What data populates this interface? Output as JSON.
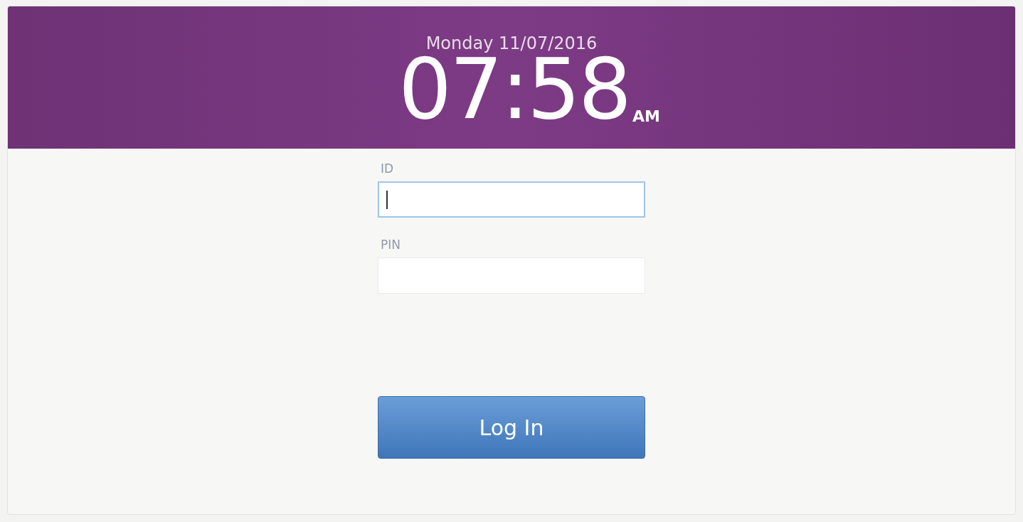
{
  "header": {
    "date": "Monday 11/07/2016",
    "time": "07:58",
    "meridiem": "AM"
  },
  "fields": [
    {
      "label": "ID",
      "focused": true
    },
    {
      "label": "PIN",
      "focused": false
    }
  ],
  "button": {
    "label": "Log In"
  }
}
